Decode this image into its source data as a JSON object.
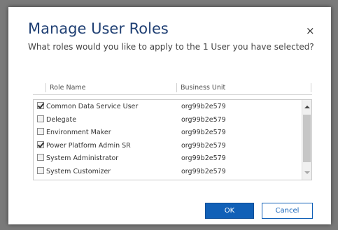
{
  "dialog": {
    "title": "Manage User Roles",
    "subtitle": "What roles would you like to apply to the 1 User you have selected?",
    "close_glyph": "×"
  },
  "grid": {
    "columns": [
      "Role Name",
      "Business Unit"
    ],
    "rows": [
      {
        "role": "Common Data Service User",
        "business_unit": "org99b2e579",
        "checked": true
      },
      {
        "role": "Delegate",
        "business_unit": "org99b2e579",
        "checked": false
      },
      {
        "role": "Environment Maker",
        "business_unit": "org99b2e579",
        "checked": false
      },
      {
        "role": "Power Platform Admin SR",
        "business_unit": "org99b2e579",
        "checked": true
      },
      {
        "role": "System Administrator",
        "business_unit": "org99b2e579",
        "checked": false
      },
      {
        "role": "System Customizer",
        "business_unit": "org99b2e579",
        "checked": false
      }
    ]
  },
  "buttons": {
    "ok": "OK",
    "cancel": "Cancel"
  },
  "icons": {
    "close": "close-icon",
    "checkbox": "checkbox-icon",
    "scroll_up": "scroll-up-arrow-icon",
    "scroll_down": "scroll-down-arrow-icon"
  },
  "colors": {
    "title": "#1f3f73",
    "accent": "#1160b7"
  }
}
